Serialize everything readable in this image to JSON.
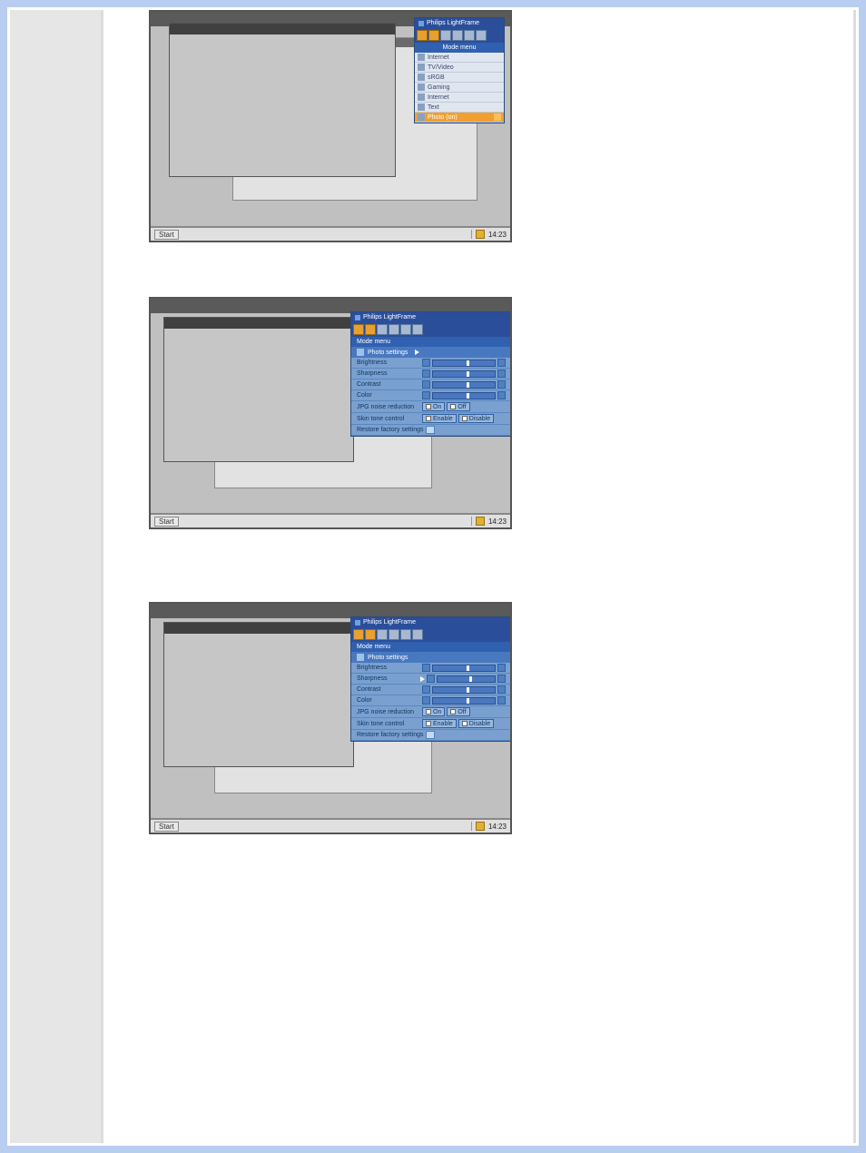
{
  "app_title": "Philips LightFrame",
  "mode_menu_label": "Mode menu",
  "mode_items": [
    {
      "label": "Internet"
    },
    {
      "label": "TV/Video"
    },
    {
      "label": "sRGB"
    },
    {
      "label": "Gaming"
    },
    {
      "label": "Internet"
    },
    {
      "label": "Text"
    },
    {
      "label": "Photo (on)"
    }
  ],
  "photo_settings_label": "Photo settings",
  "settings": {
    "brightness": "Brightness",
    "sharpness": "Sharpness",
    "contrast": "Contrast",
    "color": "Color",
    "jpg_noise": "JPG noise reduction",
    "skin_tone": "Skin tone control",
    "restore": "Restore factory settings"
  },
  "options": {
    "on": "On",
    "off": "Off",
    "enable": "Enable",
    "disable": "Disable"
  },
  "taskbar": {
    "start": "Start",
    "time1": "14:23",
    "time2": "14:23",
    "time3": "14:23"
  }
}
